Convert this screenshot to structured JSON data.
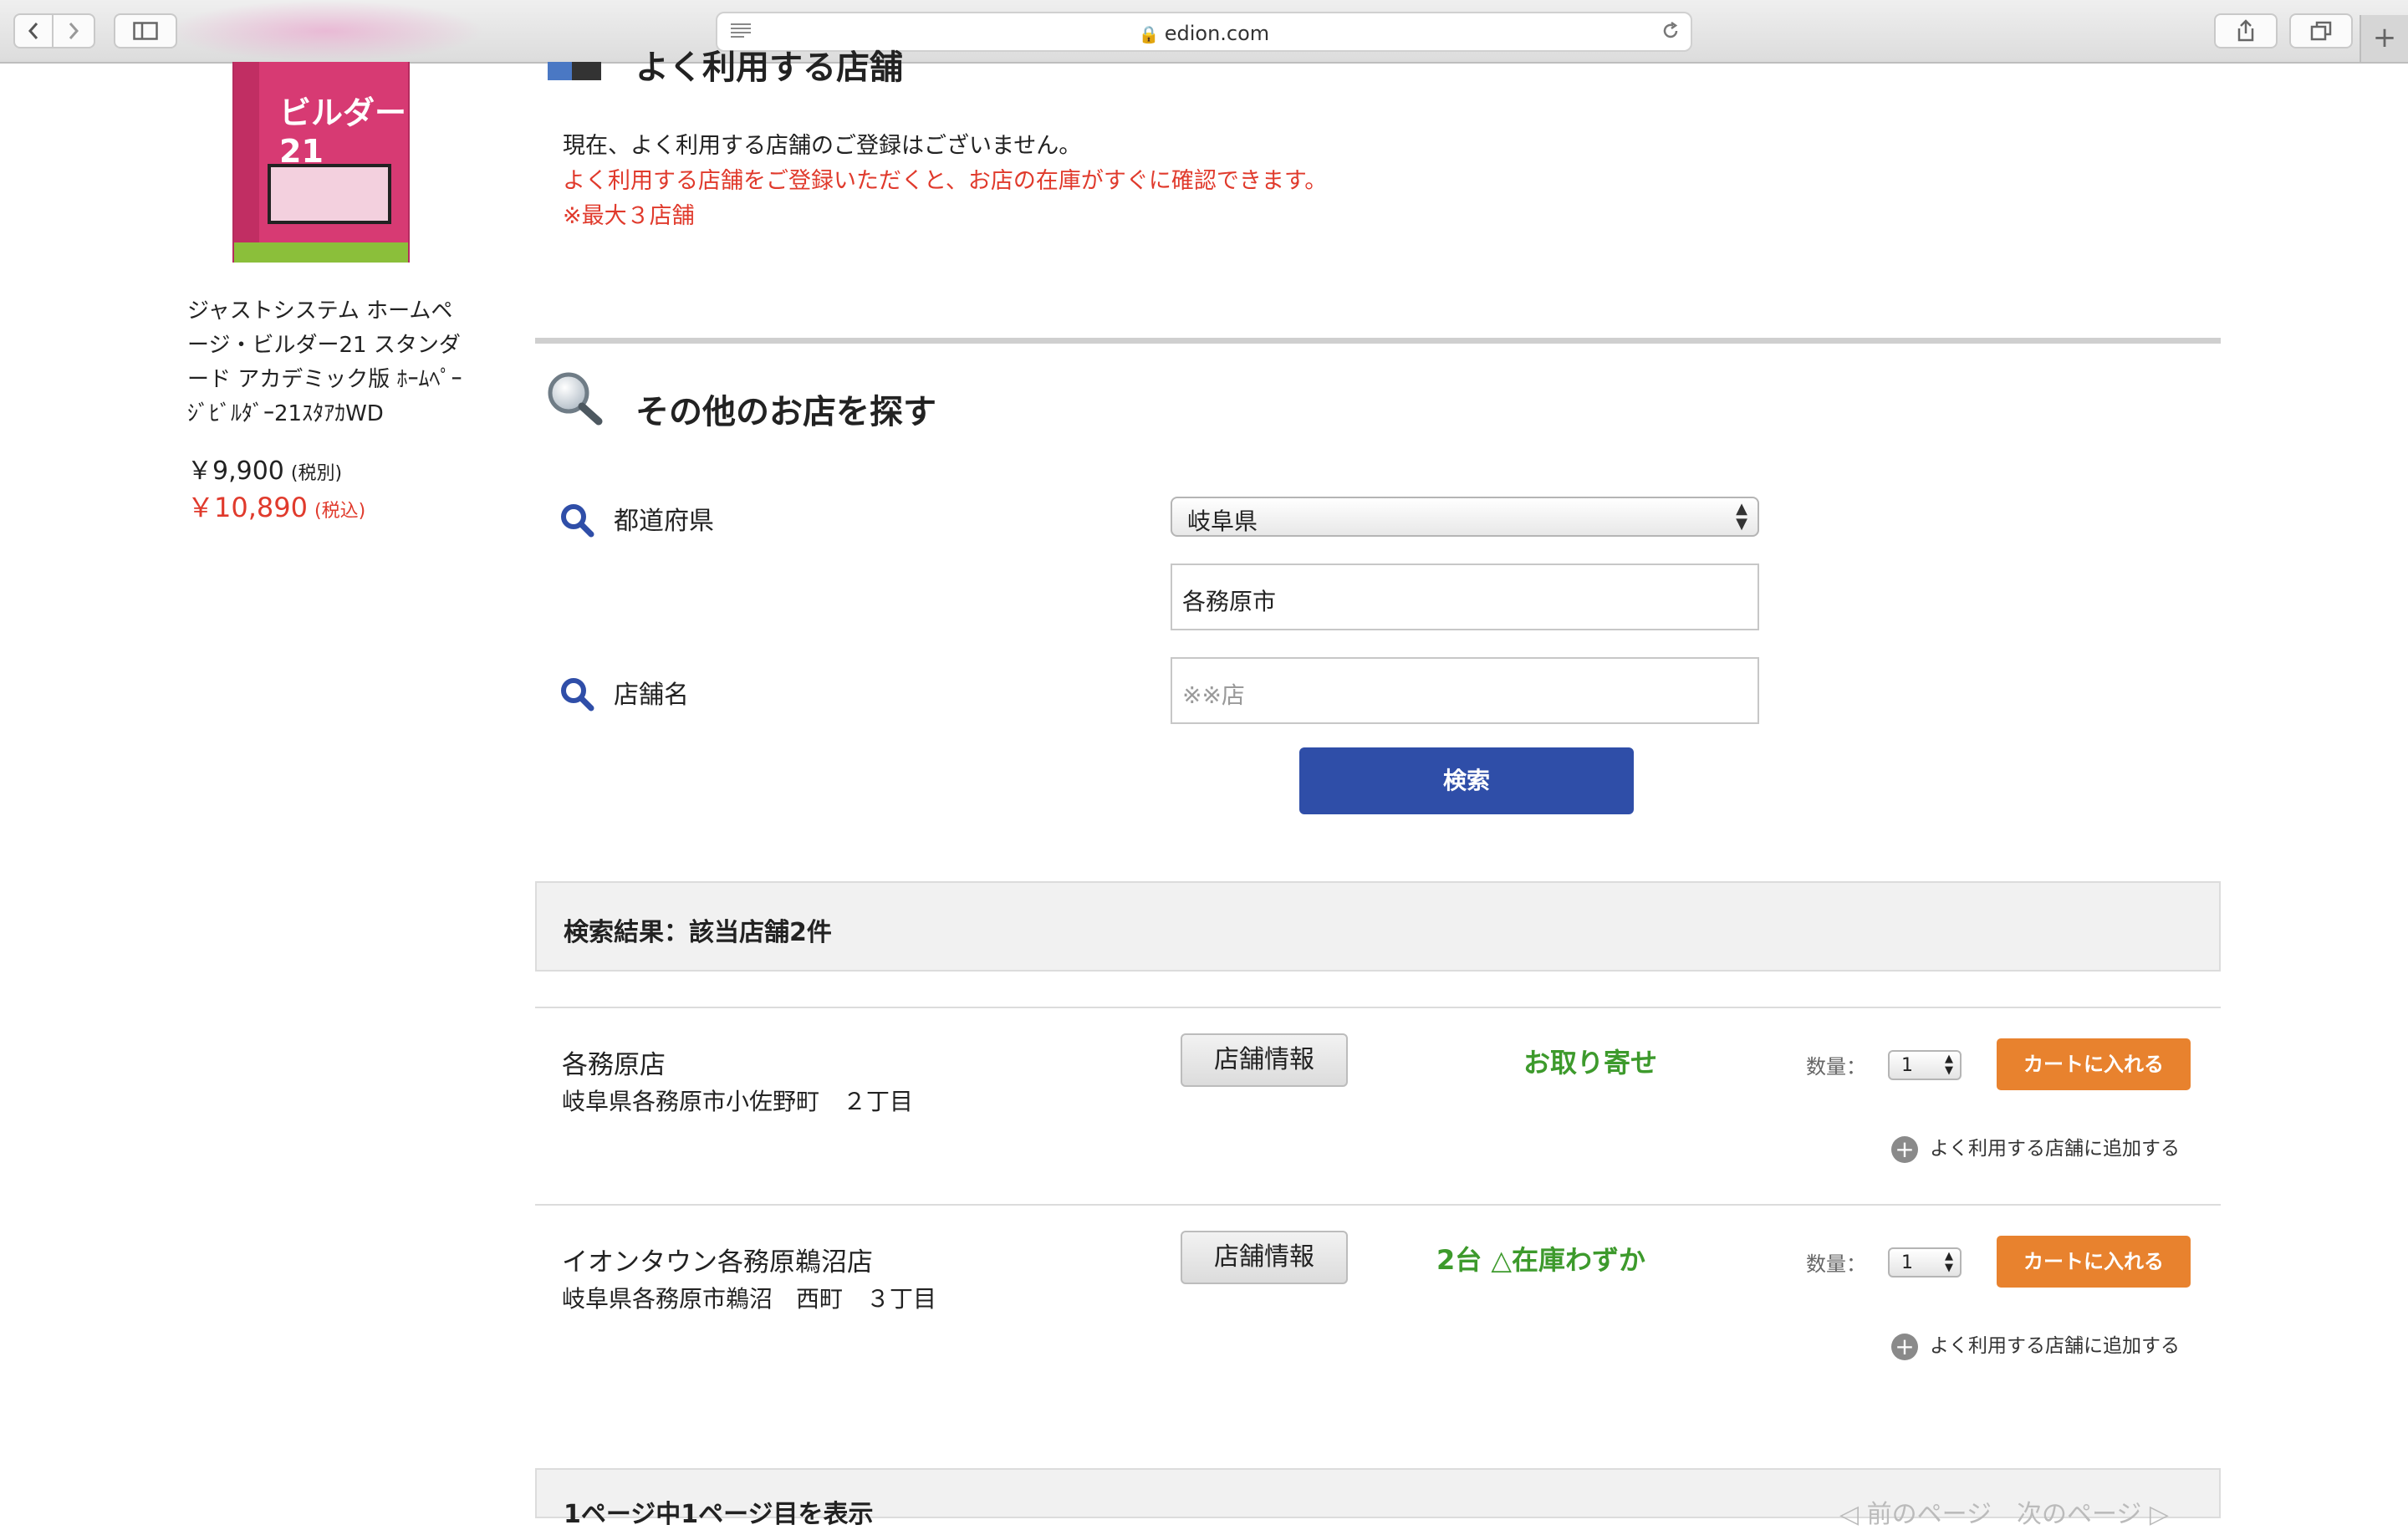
{
  "browser": {
    "url": "edion.com",
    "back_icon": "chevron-left-icon",
    "forward_icon": "chevron-right-icon",
    "sidebar_icon": "sidebar-icon",
    "reader_icon": "reader-icon",
    "reload_icon": "reload-icon",
    "share_icon": "share-icon",
    "tabs_icon": "tabs-icon",
    "new_tab_icon": "plus-icon"
  },
  "product": {
    "box_label": "ビルダー21",
    "name": "ジャストシステム ホームページ・ビルダー21 スタンダード アカデミック版 ﾎｰﾑﾍﾟｰｼﾞﾋﾞﾙﾀﾞｰ21ｽﾀｱｶWD",
    "price_ex": "￥9,900",
    "price_ex_note": "(税別)",
    "price_in": "￥10,890",
    "price_in_note": "(税込)"
  },
  "favorites": {
    "title": "よく利用する店舗",
    "message": "現在、よく利用する店舗のご登録はございません。",
    "note1": "よく利用する店舗をご登録いただくと、お店の在庫がすぐに確認できます。",
    "note2": "※最大３店舗"
  },
  "search": {
    "title": "その他のお店を探す",
    "prefecture_label": "都道府県",
    "prefecture_value": "岐阜県",
    "city_value": "各務原市",
    "store_label": "店舗名",
    "store_placeholder": "※※店",
    "button_label": "検索"
  },
  "results": {
    "header": "検索結果：該当店舗2件",
    "qty_label": "数量：",
    "info_button": "店舗情報",
    "cart_button": "カートに入れる",
    "add_fav": "よく利用する店舗に追加する",
    "stores": [
      {
        "name": "各務原店",
        "address": "岐阜県各務原市小佐野町　２丁目",
        "stock": "お取り寄せ",
        "qty": "1"
      },
      {
        "name": "イオンタウン各務原鵜沼店",
        "address": "岐阜県各務原市鵜沼　西町　３丁目",
        "stock": "2台 △在庫わずか",
        "qty": "1"
      }
    ]
  },
  "pager": {
    "left": "1ページ中1ページ目を表示",
    "right": "◁ 前のページ　次のページ ▷"
  }
}
